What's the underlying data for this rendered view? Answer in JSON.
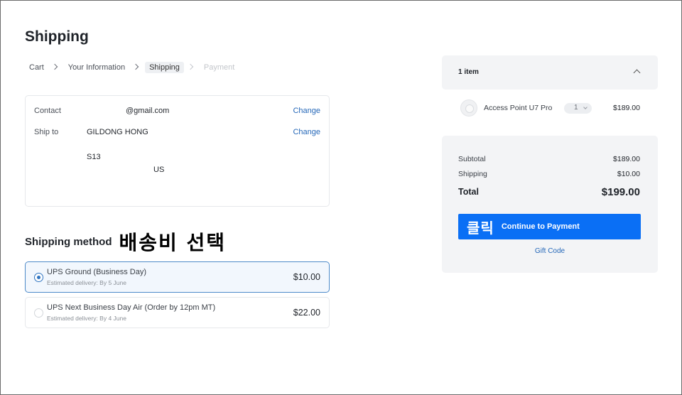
{
  "page": {
    "title": "Shipping"
  },
  "breadcrumb": {
    "items": [
      {
        "label": "Cart",
        "state": "link"
      },
      {
        "label": "Your Information",
        "state": "link"
      },
      {
        "label": "Shipping",
        "state": "current"
      },
      {
        "label": "Payment",
        "state": "disabled"
      }
    ]
  },
  "info": {
    "contact_label": "Contact",
    "contact_value": "@gmail.com",
    "ship_label": "Ship to",
    "ship_name": "GILDONG HONG",
    "ship_line1": "S13",
    "ship_country": "US",
    "change_label": "Change"
  },
  "shipping_method": {
    "title": "Shipping method",
    "annotation": "배송비 선택",
    "options": [
      {
        "name": "UPS Ground (Business Day)",
        "eta": "Estimated delivery: By 5 June",
        "price": "$10.00",
        "selected": true
      },
      {
        "name": "UPS Next Business Day Air (Order by 12pm MT)",
        "eta": "Estimated delivery: By 4 June",
        "price": "$22.00",
        "selected": false
      }
    ]
  },
  "summary": {
    "item_count": "1 item",
    "product": {
      "name": "Access Point U7 Pro",
      "qty": "1",
      "price": "$189.00"
    },
    "subtotal_label": "Subtotal",
    "subtotal_value": "$189.00",
    "shipping_label": "Shipping",
    "shipping_value": "$10.00",
    "total_label": "Total",
    "total_value": "$199.00",
    "pay_annotation": "클릭",
    "pay_button": "Continue to Payment",
    "gift_code": "Gift Code"
  },
  "colors": {
    "accent": "#0a6ff5",
    "link": "#2467b8",
    "selected_border": "#4d8ac9",
    "panel_bg": "#f3f4f6"
  }
}
